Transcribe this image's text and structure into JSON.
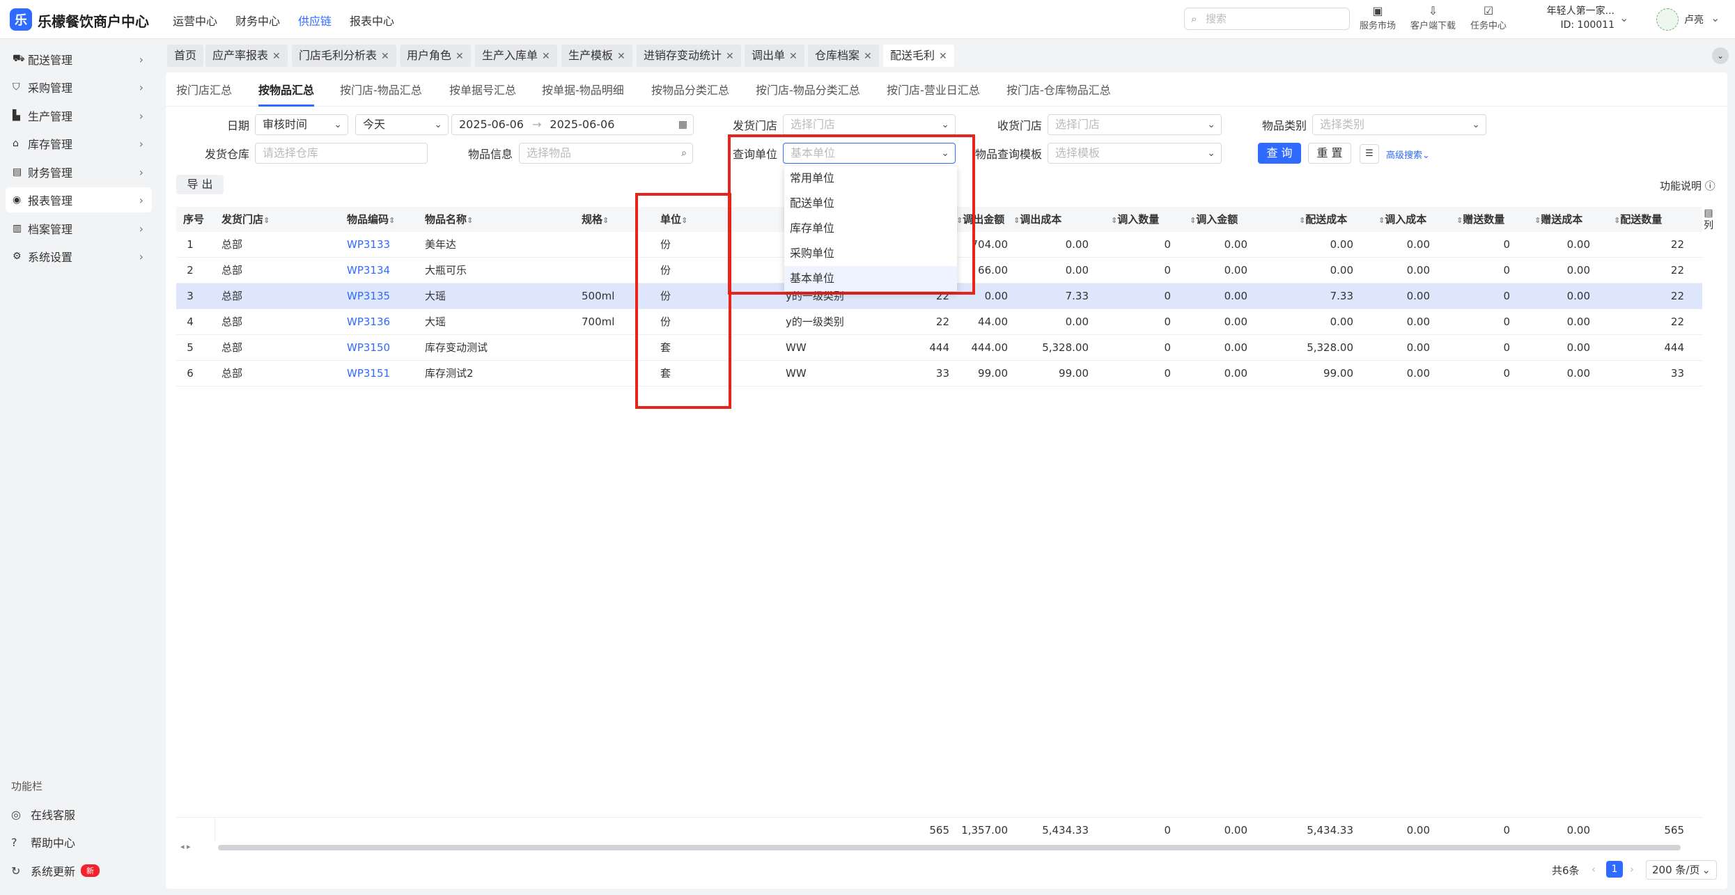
{
  "app": {
    "brand": "乐檬餐饮商户中心",
    "logo_letter": "乐",
    "accent": "#2f6bff"
  },
  "top_nav": [
    "运营中心",
    "财务中心",
    "供应链",
    "报表中心"
  ],
  "search": {
    "placeholder": "搜索"
  },
  "tools": [
    {
      "icon": "store-icon",
      "label": "服务市场"
    },
    {
      "icon": "download-icon",
      "label": "客户端下载"
    },
    {
      "icon": "task-icon",
      "label": "任务中心"
    }
  ],
  "user": {
    "org": "年轻人第一家...",
    "id": "ID: 100011",
    "name": "卢亮"
  },
  "sidebar": [
    {
      "icon": "truck-icon",
      "label": "配送管理"
    },
    {
      "icon": "cart-icon",
      "label": "采购管理"
    },
    {
      "icon": "factory-icon",
      "label": "生产管理"
    },
    {
      "icon": "warehouse-icon",
      "label": "库存管理"
    },
    {
      "icon": "finance-icon",
      "label": "财务管理"
    },
    {
      "icon": "report-icon",
      "label": "报表管理"
    },
    {
      "icon": "archive-icon",
      "label": "档案管理"
    },
    {
      "icon": "gear-icon",
      "label": "系统设置"
    }
  ],
  "func_bar": {
    "title": "功能栏",
    "items": [
      "在线客服",
      "帮助中心",
      "系统更新"
    ],
    "new_badge": "新"
  },
  "tabs": [
    "首页",
    "应产率报表",
    "门店毛利分析表",
    "用户角色",
    "生产入库单",
    "生产模板",
    "进销存变动统计",
    "调出单",
    "仓库档案",
    "配送毛利"
  ],
  "subtabs": [
    "按门店汇总",
    "按物品汇总",
    "按门店-物品汇总",
    "按单据号汇总",
    "按单据-物品明细",
    "按物品分类汇总",
    "按门店-物品分类汇总",
    "按门店-营业日汇总",
    "按门店-仓库物品汇总"
  ],
  "filters": {
    "date_label": "日期",
    "date_type": "审核时间",
    "date_preset": "今天",
    "date_from": "2025-06-06",
    "date_to": "2025-06-06",
    "ship_store_label": "发货门店",
    "ship_store_ph": "选择门店",
    "recv_store_label": "收货门店",
    "recv_store_ph": "选择门店",
    "category_label": "物品类别",
    "category_ph": "选择类别",
    "warehouse_label": "发货仓库",
    "warehouse_ph": "请选择仓库",
    "item_label": "物品信息",
    "item_ph": "选择物品",
    "unit_label": "查询单位",
    "unit_ph": "基本单位",
    "template_label": "物品查询模板",
    "template_ph": "选择模板",
    "query_btn": "查 询",
    "reset_btn": "重 置",
    "advanced": "高级搜索"
  },
  "export_btn": "导 出",
  "help_link": "功能说明",
  "unit_dropdown": {
    "options": [
      "常用单位",
      "配送单位",
      "库存单位",
      "采购单位",
      "基本单位"
    ],
    "selected": "基本单位"
  },
  "table": {
    "headers": [
      "序号",
      "发货门店",
      "物品编码",
      "物品名称",
      "规格",
      "单位",
      "",
      "调出金额",
      "调出成本",
      "调入数量",
      "调入金额",
      "配送成本",
      "调入成本",
      "赠送数量",
      "赠送成本",
      "配送数量"
    ],
    "rows": [
      [
        "1",
        "总部",
        "WP3133",
        "美年达",
        "",
        "份",
        "",
        "",
        "704.00",
        "0.00",
        "0",
        "0.00",
        "0.00",
        "0.00",
        "0",
        "0.00",
        "22"
      ],
      [
        "2",
        "总部",
        "WP3134",
        "大瓶可乐",
        "",
        "份",
        "",
        "",
        "66.00",
        "0.00",
        "0",
        "0.00",
        "0.00",
        "0.00",
        "0",
        "0.00",
        "22"
      ],
      [
        "3",
        "总部",
        "WP3135",
        "大瑶",
        "500ml",
        "份",
        "y的一级类别",
        "22",
        "0.00",
        "7.33",
        "0",
        "0.00",
        "7.33",
        "0.00",
        "0",
        "0.00",
        "22"
      ],
      [
        "4",
        "总部",
        "WP3136",
        "大瑶",
        "700ml",
        "份",
        "y的一级类别",
        "22",
        "44.00",
        "0.00",
        "0",
        "0.00",
        "0.00",
        "0.00",
        "0",
        "0.00",
        "22"
      ],
      [
        "5",
        "总部",
        "WP3150",
        "库存变动测试",
        "",
        "套",
        "WW",
        "444",
        "444.00",
        "5,328.00",
        "0",
        "0.00",
        "5,328.00",
        "0.00",
        "0",
        "0.00",
        "444"
      ],
      [
        "6",
        "总部",
        "WP3151",
        "库存测试2",
        "",
        "套",
        "WW",
        "33",
        "99.00",
        "99.00",
        "0",
        "0.00",
        "99.00",
        "0.00",
        "0",
        "0.00",
        "33"
      ]
    ],
    "highlight_row": 3,
    "totals": [
      "565",
      "1,357.00",
      "5,434.33",
      "0",
      "0.00",
      "5,434.33",
      "0.00",
      "0",
      "0.00",
      "565"
    ],
    "col_config": "列"
  },
  "pagination": {
    "total": "共6条",
    "page": "1",
    "page_size": "200 条/页"
  }
}
